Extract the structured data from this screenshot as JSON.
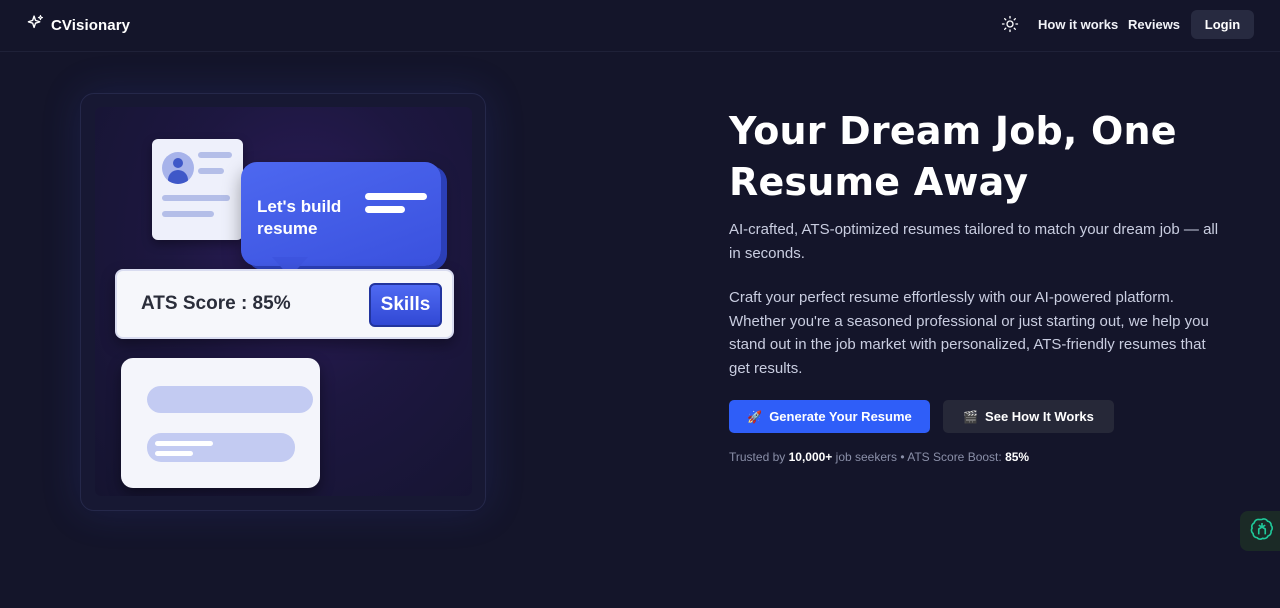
{
  "nav": {
    "brand": "CVisionary",
    "links": [
      {
        "label": "How it works"
      },
      {
        "label": "Reviews"
      }
    ],
    "login": "Login"
  },
  "illustration": {
    "bubble_text": "Let's build resume",
    "ats_label": "ATS Score : 85%",
    "skills_label": "Skills"
  },
  "hero": {
    "headline": "Your Dream Job, One Resume Away",
    "subtitle": "AI-crafted, ATS-optimized resumes tailored to match your dream job — all in seconds.",
    "description": "Craft your perfect resume effortlessly with our AI-powered platform. Whether you're a seasoned professional or just starting out, we help you stand out in the job market with personalized, ATS-friendly resumes that get results.",
    "primary_cta": {
      "icon": "🚀",
      "label": "Generate Your Resume"
    },
    "secondary_cta": {
      "icon": "🎬",
      "label": "See How It Works"
    },
    "trust": {
      "prefix": "Trusted by",
      "count": "10,000+",
      "middle": "job seekers • ATS Score Boost:",
      "boost": "85%"
    }
  },
  "colors": {
    "background": "#14152a",
    "primary": "#2f5ef8",
    "secondary": "#262838",
    "assistant": "#1fc99a"
  }
}
